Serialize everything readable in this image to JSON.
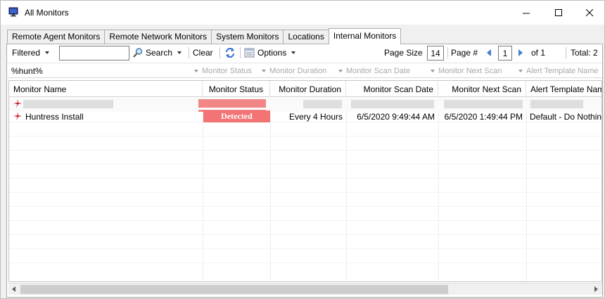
{
  "window": {
    "title": "All Monitors"
  },
  "tabs": [
    {
      "label": "Remote Agent Monitors",
      "active": false
    },
    {
      "label": "Remote Network Monitors",
      "active": false
    },
    {
      "label": "System Monitors",
      "active": false
    },
    {
      "label": "Locations",
      "active": false
    },
    {
      "label": "Internal Monitors",
      "active": true
    }
  ],
  "toolbar": {
    "filter_label": "Filtered",
    "search_value": "",
    "search_label": "Search",
    "clear_label": "Clear",
    "options_label": "Options",
    "page_size_label": "Page Size",
    "page_size_value": "14",
    "page_label": "Page #",
    "page_value": "1",
    "of_label": "of 1",
    "total_label": "Total: 2"
  },
  "filter_row": {
    "name_filter": "%hunt%",
    "status_placeholder": "Monitor Status",
    "duration_placeholder": "Monitor Duration",
    "scan_date_placeholder": "Monitor Scan Date",
    "next_scan_placeholder": "Monitor Next Scan",
    "template_placeholder": "Alert Template Name"
  },
  "columns": [
    "Monitor Name",
    "Monitor Status",
    "Monitor Duration",
    "Monitor Scan Date",
    "Monitor Next Scan",
    "Alert Template Name"
  ],
  "rows": [
    {
      "name": "",
      "status": "",
      "duration": "",
      "scan_date": "",
      "next_scan": "",
      "template": "",
      "redacted": true
    },
    {
      "name": "Huntress Install",
      "status": "Detected",
      "duration": "Every 4 Hours",
      "scan_date": "6/5/2020 9:49:44 AM",
      "next_scan": "6/5/2020 1:49:44 PM",
      "template": "Default - Do Nothing",
      "redacted": false
    }
  ],
  "colors": {
    "status_detected": "#f27474",
    "nav_arrow": "#3d7fd4",
    "row_icon": "#c0202a"
  }
}
